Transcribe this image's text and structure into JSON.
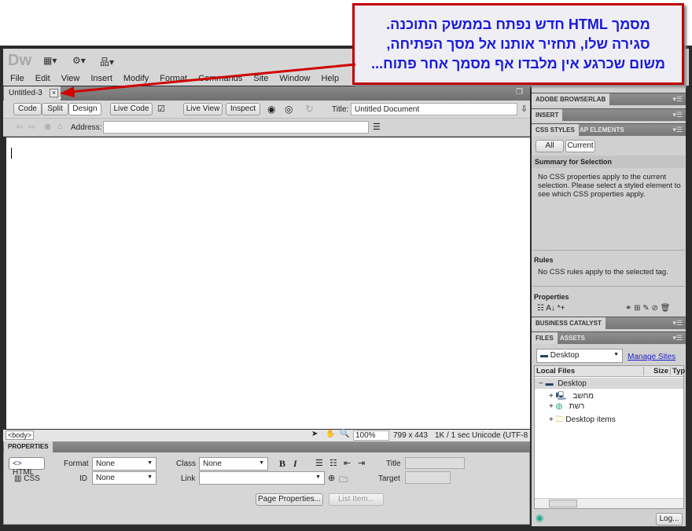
{
  "callout": {
    "lines": [
      "מסמך HTML חדש נפתח בממשק התוכנה.",
      "סגירה שלו, תחזיר אותנו אל מסך הפתיחה,",
      "משום שכרגע אין מלבדו אף מסמך אחר פתוח..."
    ],
    "border_color": "#c00000",
    "text_color": "#1a1adc"
  },
  "app": {
    "logo": "Dw"
  },
  "menu": [
    "File",
    "Edit",
    "View",
    "Insert",
    "Modify",
    "Format",
    "Commands",
    "Site",
    "Window",
    "Help"
  ],
  "document_tab": {
    "label": "Untitled-3",
    "close": "×"
  },
  "toolbar": {
    "code": "Code",
    "split": "Split",
    "design": "Design",
    "live_code": "Live Code",
    "live_view": "Live View",
    "inspect": "Inspect",
    "title_label": "Title:",
    "title_value": "Untitled Document"
  },
  "address": {
    "label": "Address:",
    "value": ""
  },
  "status": {
    "tag": "<body>",
    "zoom": "100%",
    "size": "799 x 443",
    "download": "1K / 1 sec",
    "encoding": "Unicode (UTF-8"
  },
  "properties": {
    "header": "PROPERTIES",
    "html": "HTML",
    "css": "CSS",
    "format_label": "Format",
    "format_value": "None",
    "id_label": "ID",
    "id_value": "None",
    "class_label": "Class",
    "class_value": "None",
    "link_label": "Link",
    "link_value": "",
    "bold": "B",
    "italic": "I",
    "title_label": "Title",
    "target_label": "Target",
    "page_properties": "Page Properties...",
    "list_item": "List Item..."
  },
  "panels": {
    "browserlab": "ADOBE BROWSERLAB",
    "insert": "INSERT",
    "css_styles": "CSS STYLES",
    "ap_elements": "AP ELEMENTS",
    "all": "All",
    "current": "Current",
    "summary_title": "Summary for Selection",
    "summary_text": "No CSS properties apply to the current selection.  Please select a styled element to see which CSS properties apply.",
    "rules_title": "Rules",
    "rules_text": "No CSS rules apply to the selected tag.",
    "properties_title": "Properties",
    "business_catalyst": "BUSINESS CATALYST",
    "files": "FILES",
    "assets": "ASSETS",
    "site_select": "Desktop",
    "manage_sites": "Manage Sites",
    "columns": [
      "Local Files",
      "Size",
      "Typ"
    ],
    "tree": [
      {
        "label": "Desktop",
        "expander": "−"
      },
      {
        "label": "מחשב",
        "expander": "+"
      },
      {
        "label": "רשת",
        "expander": "+"
      },
      {
        "label": "Desktop items",
        "expander": "+"
      }
    ],
    "log": "Log..."
  }
}
